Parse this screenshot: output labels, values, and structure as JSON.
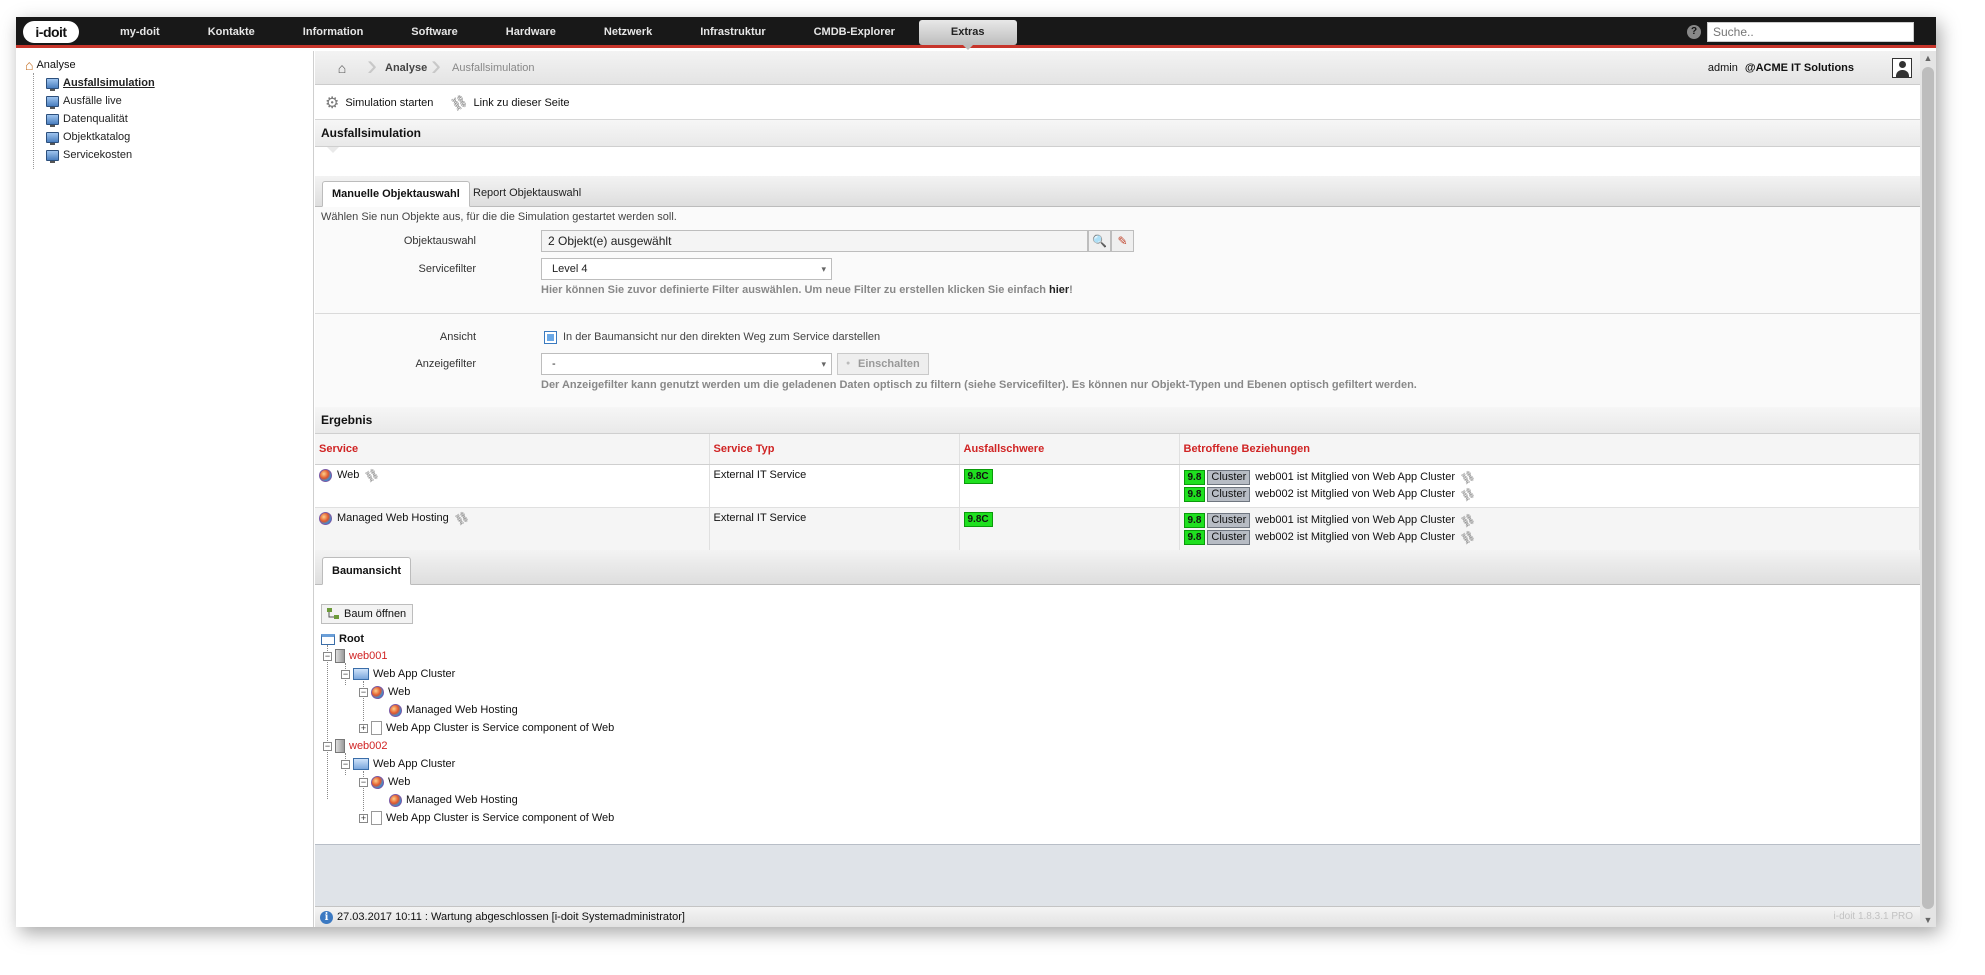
{
  "app": {
    "logo_text": "i-doit",
    "nav": [
      "my-doit",
      "Kontakte",
      "Information",
      "Software",
      "Hardware",
      "Netzwerk",
      "Infrastruktur",
      "CMDB-Explorer",
      "Extras"
    ],
    "active_nav": "Extras",
    "search_placeholder": "Suche.."
  },
  "sidebar": {
    "root_label": "Analyse",
    "items": [
      {
        "label": "Ausfallsimulation",
        "active": true
      },
      {
        "label": "Ausfälle live"
      },
      {
        "label": "Datenqualität"
      },
      {
        "label": "Objektkatalog"
      },
      {
        "label": "Servicekosten"
      }
    ]
  },
  "breadcrumb": {
    "items": [
      "Analyse",
      "Ausfallsimulation"
    ],
    "user": "admin",
    "tenant": "@ACME IT Solutions"
  },
  "toolbar": {
    "start_label": "Simulation starten",
    "link_label": "Link zu dieser Seite"
  },
  "simulation": {
    "title": "Ausfallsimulation",
    "tabs": [
      "Manuelle Objektauswahl",
      "Report Objektauswahl"
    ],
    "intro": "Wählen Sie nun Objekte aus, für die die Simulation gestartet werden soll.",
    "object_label": "Objektauswahl",
    "object_value": "2 Objekt(e) ausgewählt",
    "service_filter_label": "Servicefilter",
    "service_filter_value": "Level 4",
    "service_filter_hint_pre": "Hier können Sie zuvor definierte Filter auswählen. Um neue Filter zu erstellen klicken Sie einfach ",
    "service_filter_hint_link": "hier",
    "service_filter_hint_post": "!",
    "view_label": "Ansicht",
    "view_checkbox_label": "In der Baumansicht nur den direkten Weg zum Service darstellen",
    "display_filter_label": "Anzeigefilter",
    "display_filter_value": "-",
    "apply_button": "Einschalten",
    "display_filter_hint": "Der Anzeigefilter kann genutzt werden um die geladenen Daten optisch zu filtern (siehe Servicefilter). Es können nur Objekt-Typen und Ebenen optisch gefiltert werden."
  },
  "result": {
    "title": "Ergebnis",
    "columns": [
      "Service",
      "Service Typ",
      "Ausfallschwere",
      "Betroffene Beziehungen"
    ],
    "rows": [
      {
        "service": "Web",
        "type": "External IT Service",
        "severity": "9.8C",
        "relations": [
          {
            "score": "9.8",
            "tag": "Cluster",
            "text": "web001 ist Mitglied von Web App Cluster"
          },
          {
            "score": "9.8",
            "tag": "Cluster",
            "text": "web002 ist Mitglied von Web App Cluster"
          }
        ]
      },
      {
        "service": "Managed Web Hosting",
        "type": "External IT Service",
        "severity": "9.8C",
        "relations": [
          {
            "score": "9.8",
            "tag": "Cluster",
            "text": "web001 ist Mitglied von Web App Cluster"
          },
          {
            "score": "9.8",
            "tag": "Cluster",
            "text": "web002 ist Mitglied von Web App Cluster"
          }
        ]
      }
    ]
  },
  "treeview": {
    "tab": "Baumansicht",
    "open_button": "Baum öffnen",
    "root": "Root",
    "nodes": [
      "web001",
      "Web App Cluster",
      "Web",
      "Managed Web Hosting",
      "Web App Cluster is Service component of Web",
      "web002",
      "Web App Cluster",
      "Web",
      "Managed Web Hosting",
      "Web App Cluster is Service component of Web"
    ]
  },
  "status": {
    "message": "27.03.2017 10:11 : Wartung abgeschlossen [i-doit Systemadministrator]",
    "version": "i-doit 1.8.3.1 PRO"
  },
  "colors": {
    "accent_red": "#c7352b",
    "severity_green": "#1fe01f",
    "header_red": "#d02424"
  }
}
